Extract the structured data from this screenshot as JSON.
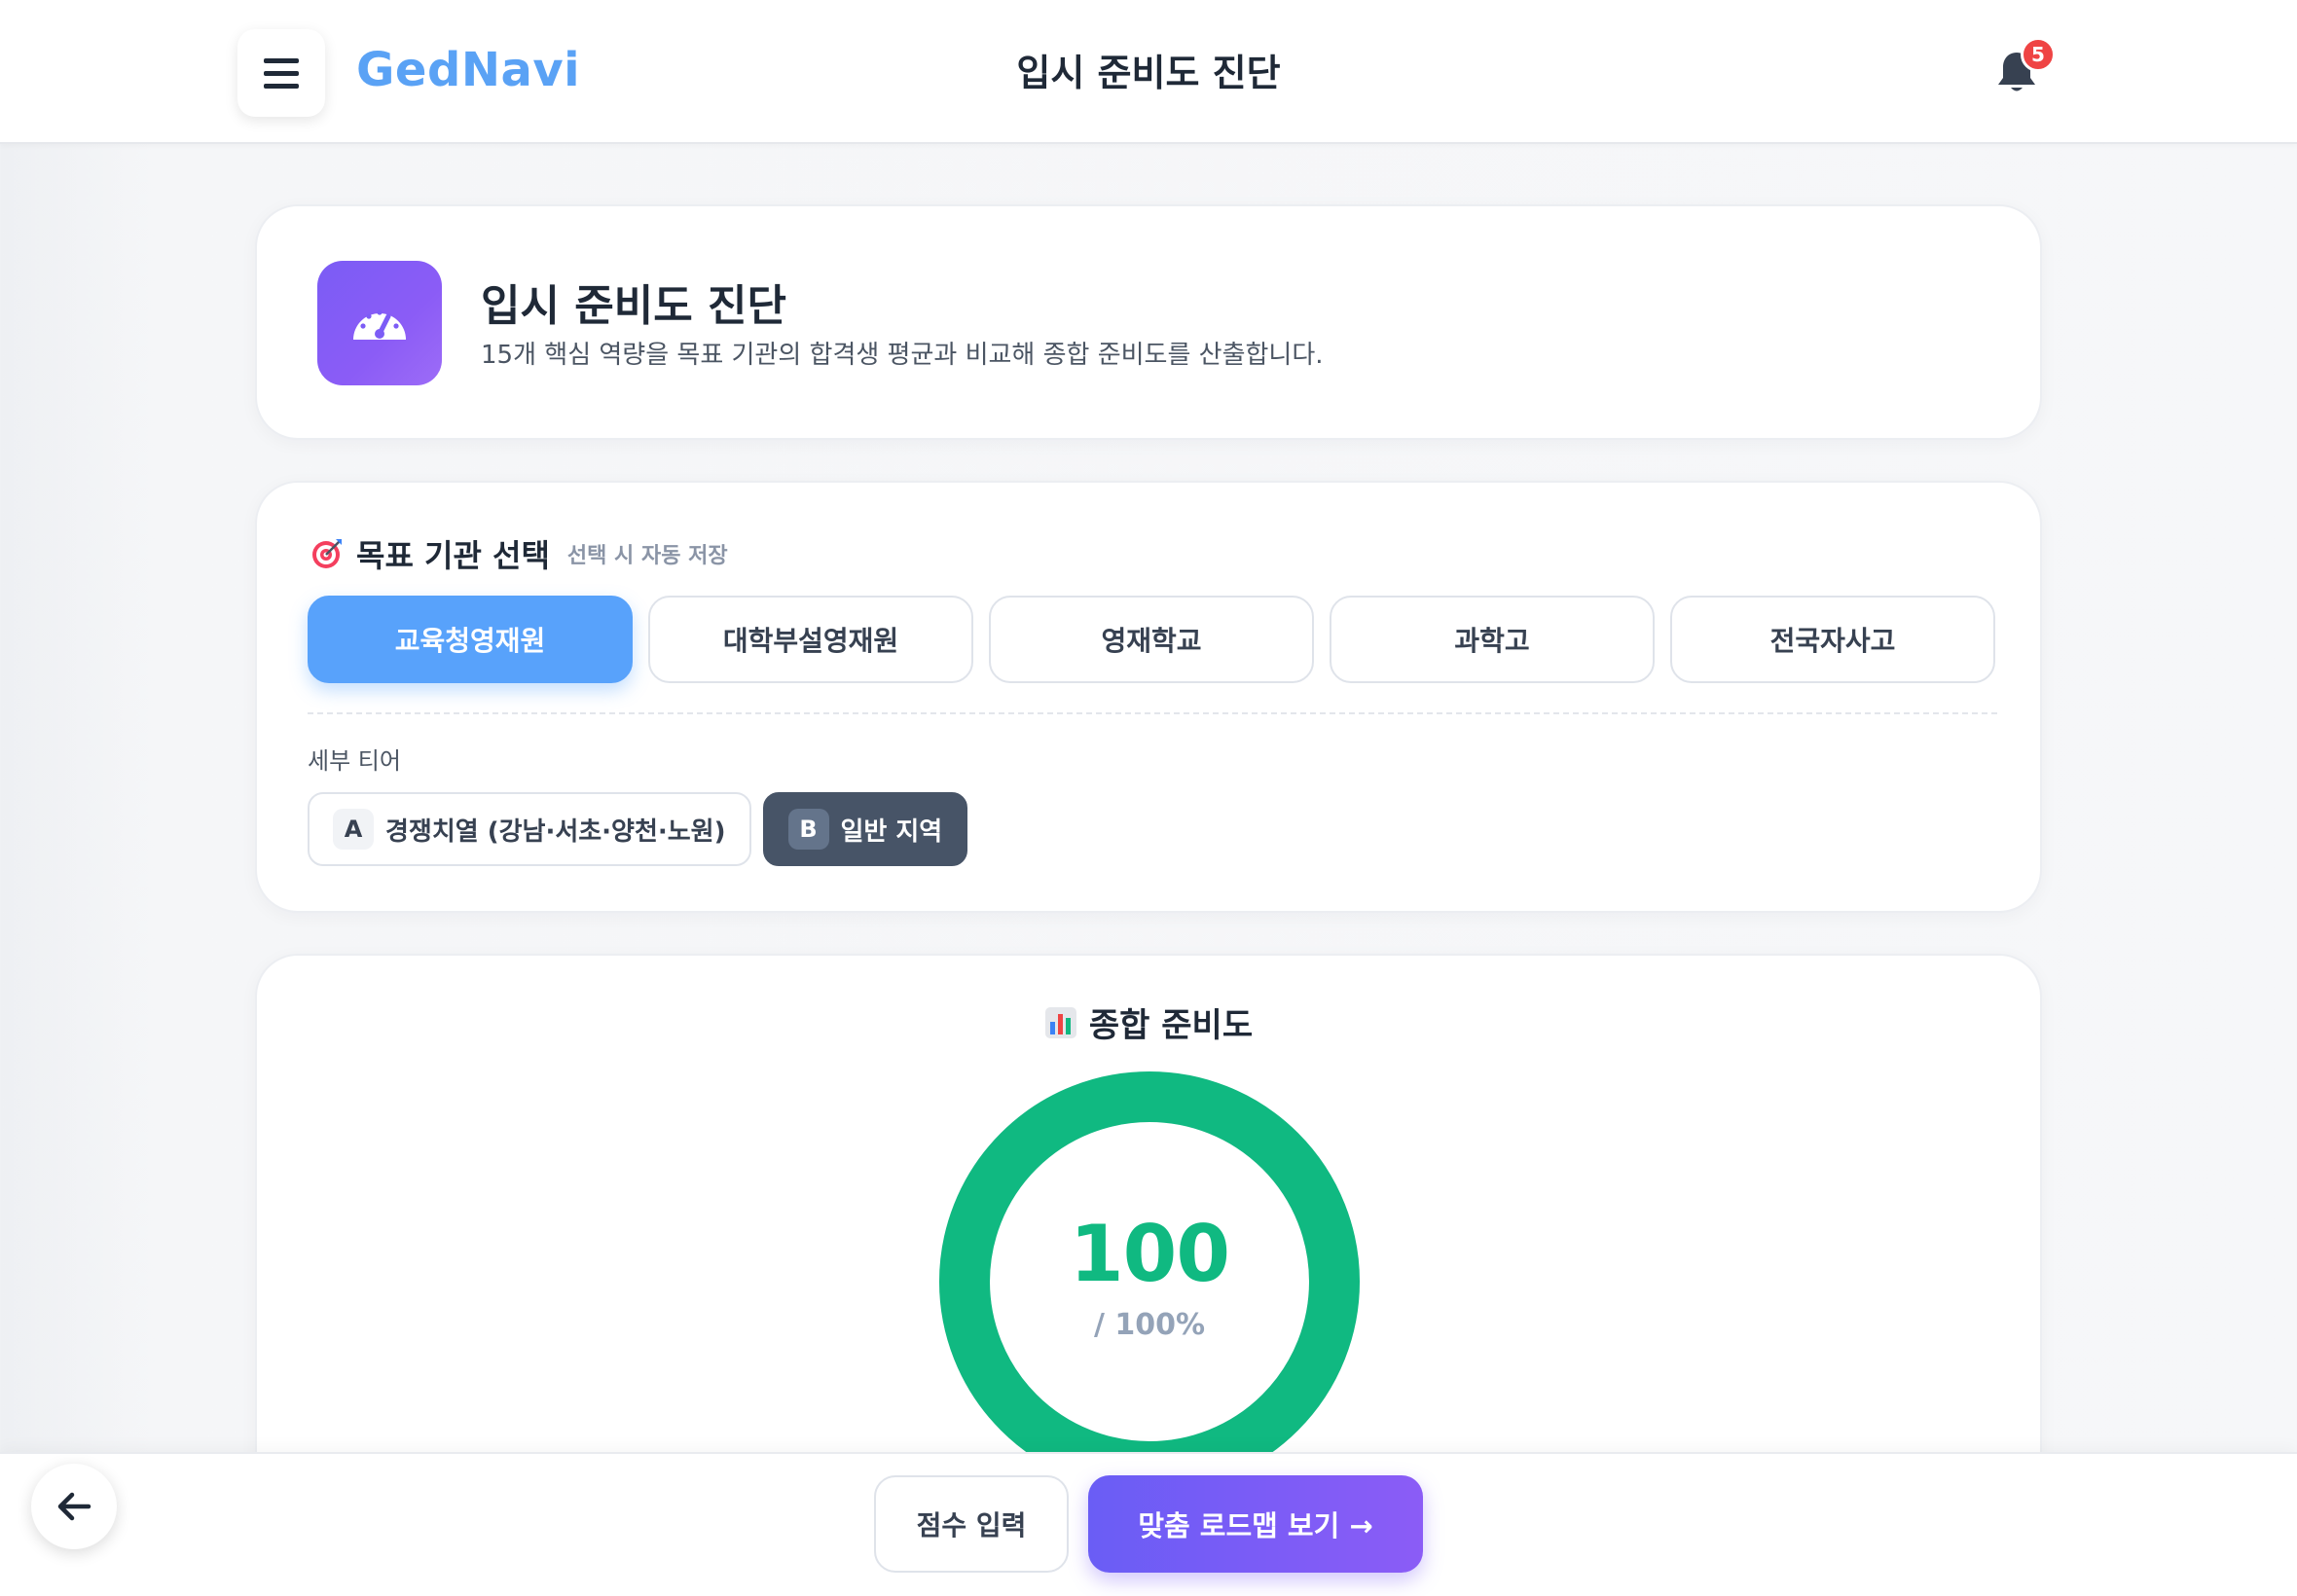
{
  "header": {
    "brand": "GedNavi",
    "title": "입시 준비도 진단",
    "notification_count": "5"
  },
  "hero": {
    "title": "입시 준비도 진단",
    "subtitle": "15개 핵심 역량을 목표 기관의 합격생 평균과 비교해 종합 준비도를 산출합니다."
  },
  "target": {
    "title": "목표 기관 선택",
    "note": "선택 시 자동 저장",
    "tabs": [
      {
        "label": "교육청영재원",
        "active": true
      },
      {
        "label": "대학부설영재원",
        "active": false
      },
      {
        "label": "영재학교",
        "active": false
      },
      {
        "label": "과학고",
        "active": false
      },
      {
        "label": "전국자사고",
        "active": false
      }
    ],
    "tier_label": "세부 티어",
    "tiers": [
      {
        "chip": "A",
        "label": "경쟁치열 (강남·서초·양천·노원)",
        "active": false
      },
      {
        "chip": "B",
        "label": "일반 지역",
        "active": true
      }
    ]
  },
  "overall": {
    "title": "종합 준비도",
    "value": "100",
    "suffix": "/ 100%",
    "ring_color": "#10b981",
    "progress_fraction": 1.0
  },
  "footer": {
    "score_input": "점수 입력",
    "roadmap": "맞춤 로드맵 보기 →"
  },
  "colors": {
    "brand": "#5aa2f5",
    "active_tab": "#58a2fb",
    "accent_purple": "#7c5cf6",
    "success": "#10b981",
    "badge": "#ef4444"
  }
}
